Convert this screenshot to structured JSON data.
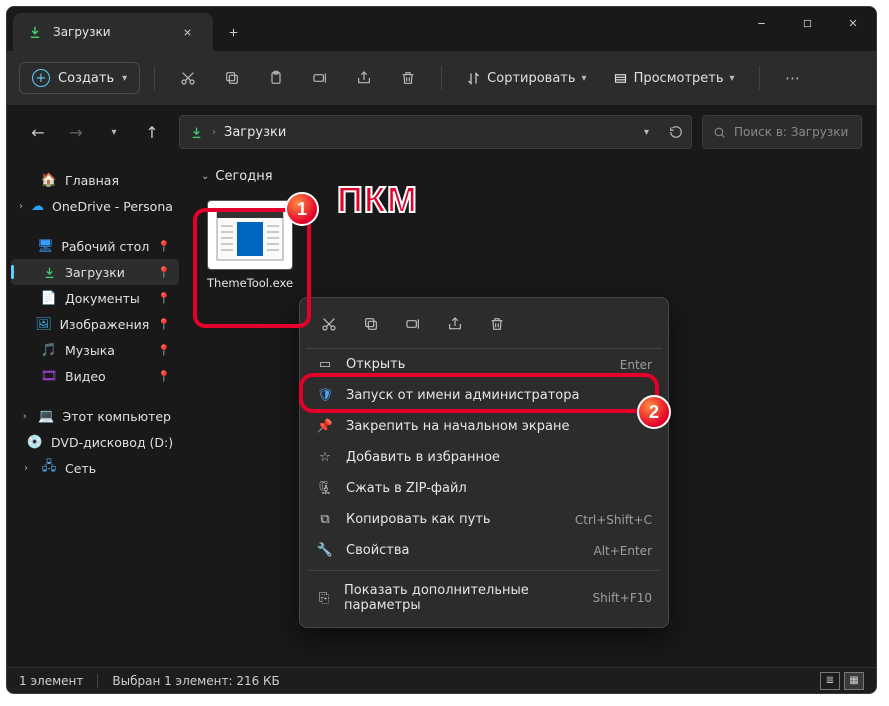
{
  "titlebar": {
    "tab_label": "Загрузки"
  },
  "toolbar": {
    "new_label": "Создать",
    "sort_label": "Сортировать",
    "view_label": "Просмотреть"
  },
  "address": {
    "folder": "Загрузки"
  },
  "search": {
    "placeholder": "Поиск в: Загрузки"
  },
  "sidebar": {
    "home": "Главная",
    "onedrive": "OneDrive - Persona",
    "desktop": "Рабочий стол",
    "downloads": "Загрузки",
    "documents": "Документы",
    "pictures": "Изображения",
    "music": "Музыка",
    "videos": "Видео",
    "this_pc": "Этот компьютер",
    "dvd": "DVD-дисковод (D:)",
    "network": "Сеть"
  },
  "content": {
    "group": "Сегодня",
    "file_name": "ThemeTool.exe"
  },
  "context_menu": {
    "open": "Открыть",
    "open_shortcut": "Enter",
    "run_admin": "Запуск от имени администратора",
    "pin_start": "Закрепить на начальном экране",
    "favorite": "Добавить в избранное",
    "zip": "Сжать в ZIP-файл",
    "copy_path": "Копировать как путь",
    "copy_path_shortcut": "Ctrl+Shift+C",
    "properties": "Свойства",
    "properties_shortcut": "Alt+Enter",
    "more": "Показать дополнительные параметры",
    "more_shortcut": "Shift+F10"
  },
  "annotations": {
    "badge1": "1",
    "badge2": "2",
    "pkm": "ПКМ"
  },
  "status": {
    "count": "1 элемент",
    "selection": "Выбран 1 элемент: 216 КБ"
  }
}
